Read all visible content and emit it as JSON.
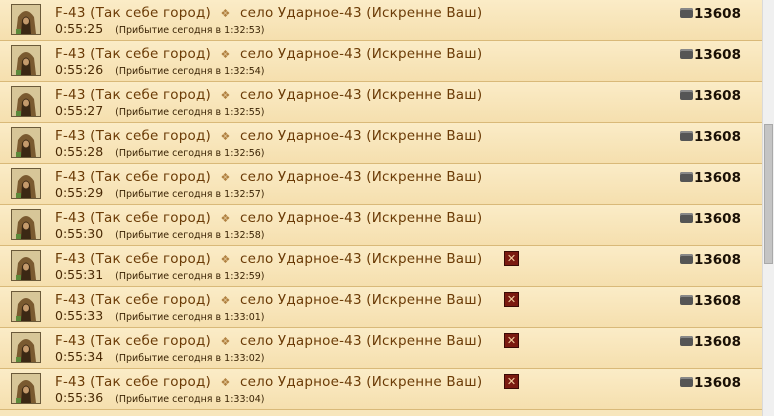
{
  "rows": [
    {
      "from_code": "F-43",
      "from_name": "(Так себе город)",
      "to_name": "село Ударное-43",
      "to_player": "(Искренне Ваш)",
      "time": "0:55:25",
      "arrival": "(Прибытие сегодня в 1:32:53)",
      "amount": "13608",
      "cancel": false
    },
    {
      "from_code": "F-43",
      "from_name": "(Так себе город)",
      "to_name": "село Ударное-43",
      "to_player": "(Искренне Ваш)",
      "time": "0:55:26",
      "arrival": "(Прибытие сегодня в 1:32:54)",
      "amount": "13608",
      "cancel": false
    },
    {
      "from_code": "F-43",
      "from_name": "(Так себе город)",
      "to_name": "село Ударное-43",
      "to_player": "(Искренне Ваш)",
      "time": "0:55:27",
      "arrival": "(Прибытие сегодня в 1:32:55)",
      "amount": "13608",
      "cancel": false
    },
    {
      "from_code": "F-43",
      "from_name": "(Так себе город)",
      "to_name": "село Ударное-43",
      "to_player": "(Искренне Ваш)",
      "time": "0:55:28",
      "arrival": "(Прибытие сегодня в 1:32:56)",
      "amount": "13608",
      "cancel": false
    },
    {
      "from_code": "F-43",
      "from_name": "(Так себе город)",
      "to_name": "село Ударное-43",
      "to_player": "(Искренне Ваш)",
      "time": "0:55:29",
      "arrival": "(Прибытие сегодня в 1:32:57)",
      "amount": "13608",
      "cancel": false
    },
    {
      "from_code": "F-43",
      "from_name": "(Так себе город)",
      "to_name": "село Ударное-43",
      "to_player": "(Искренне Ваш)",
      "time": "0:55:30",
      "arrival": "(Прибытие сегодня в 1:32:58)",
      "amount": "13608",
      "cancel": false
    },
    {
      "from_code": "F-43",
      "from_name": "(Так себе город)",
      "to_name": "село Ударное-43",
      "to_player": "(Искренне Ваш)",
      "time": "0:55:31",
      "arrival": "(Прибытие сегодня в 1:32:59)",
      "amount": "13608",
      "cancel": true
    },
    {
      "from_code": "F-43",
      "from_name": "(Так себе город)",
      "to_name": "село Ударное-43",
      "to_player": "(Искренне Ваш)",
      "time": "0:55:33",
      "arrival": "(Прибытие сегодня в 1:33:01)",
      "amount": "13608",
      "cancel": true
    },
    {
      "from_code": "F-43",
      "from_name": "(Так себе город)",
      "to_name": "село Ударное-43",
      "to_player": "(Искренне Ваш)",
      "time": "0:55:34",
      "arrival": "(Прибытие сегодня в 1:33:02)",
      "amount": "13608",
      "cancel": true
    },
    {
      "from_code": "F-43",
      "from_name": "(Так себе город)",
      "to_name": "село Ударное-43",
      "to_player": "(Искренне Ваш)",
      "time": "0:55:36",
      "arrival": "(Прибытие сегодня в 1:33:04)",
      "amount": "13608",
      "cancel": true
    }
  ],
  "icons": {
    "avatar": "hooded-figure-avatar-icon",
    "separator": "arrow-right-icon",
    "cancel": "close-icon",
    "resource": "cart-icon"
  },
  "cancel_glyph": "✕",
  "colors": {
    "row_bg": "#f7e6bd",
    "text": "#6b3b06",
    "cancel_bg": "#7a1a10"
  }
}
